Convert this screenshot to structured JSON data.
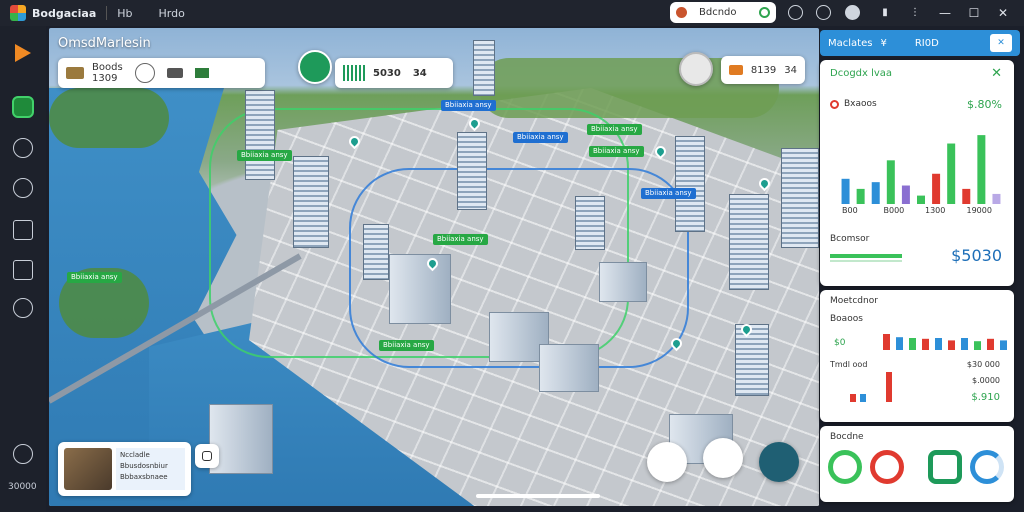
{
  "titlebar": {
    "app_name": "Bodgaciaa",
    "menu": [
      "Hb",
      "Hrdo"
    ],
    "search_text": "Bdcndo",
    "window_controls": [
      "—",
      "☐",
      "✕"
    ]
  },
  "rail": {
    "footer": "30000"
  },
  "map": {
    "title": "OmsdMarlesin",
    "card_a": {
      "label": "Boods",
      "value": "1309"
    },
    "card_b": {
      "value": "5030",
      "value2": "34"
    },
    "card_c": {
      "value": "8139",
      "value2": "34"
    },
    "tags": [
      "Bbiiaxia ansy",
      "Bbiiaxia ansy",
      "Bbiiaxia ansy",
      "Bbiiaxia ansy",
      "Bbiiaxia ansy",
      "Bbiiaxia ansy",
      "Bbiiaxia ansy",
      "Bbiiaxia ansy",
      "Bbiiaxia ansy"
    ],
    "preview": {
      "line1": "Nccladle",
      "line2": "Bbusdosnbiur",
      "line3": "Bbbaxsbnaee"
    }
  },
  "panel": {
    "header": {
      "left": "Maclates",
      "mid": "¥",
      "right": "RI0D",
      "close": "✕"
    },
    "chart1": {
      "title": "Dcogdx lvaa",
      "subtitle": "Bxaoos",
      "value": "$.80%",
      "xlabels": [
        "B00",
        "B000",
        "1300",
        "19000"
      ]
    },
    "stat": {
      "label": "Bcomsor",
      "value": "$5030"
    },
    "chart2": {
      "title": "Moetcdnor",
      "subtitle": "Boaoos",
      "row1": "$0",
      "row2_left": "Tmdl  ood",
      "row2_right": "$30 000",
      "row3_right": "$.0000",
      "value": "$.910"
    },
    "donuts": {
      "label": "Bocdne"
    }
  },
  "colors": {
    "accent": "#2d8fd8",
    "green": "#2ea44f",
    "red": "#e03a2f",
    "orange": "#f08a24"
  },
  "chart_data": [
    {
      "type": "bar",
      "categories": [
        "B00",
        "B000",
        "1300",
        "19000"
      ],
      "series": [
        {
          "values": [
            30,
            18,
            26,
            52,
            22,
            10,
            36,
            72,
            18,
            82,
            12
          ]
        }
      ],
      "ylim": [
        0,
        100
      ]
    },
    {
      "type": "bar",
      "categories": [],
      "series": [
        {
          "values": [
            20,
            16,
            15,
            14,
            15,
            12,
            15,
            11,
            14,
            12
          ]
        }
      ],
      "ylim": [
        0,
        30
      ]
    }
  ]
}
